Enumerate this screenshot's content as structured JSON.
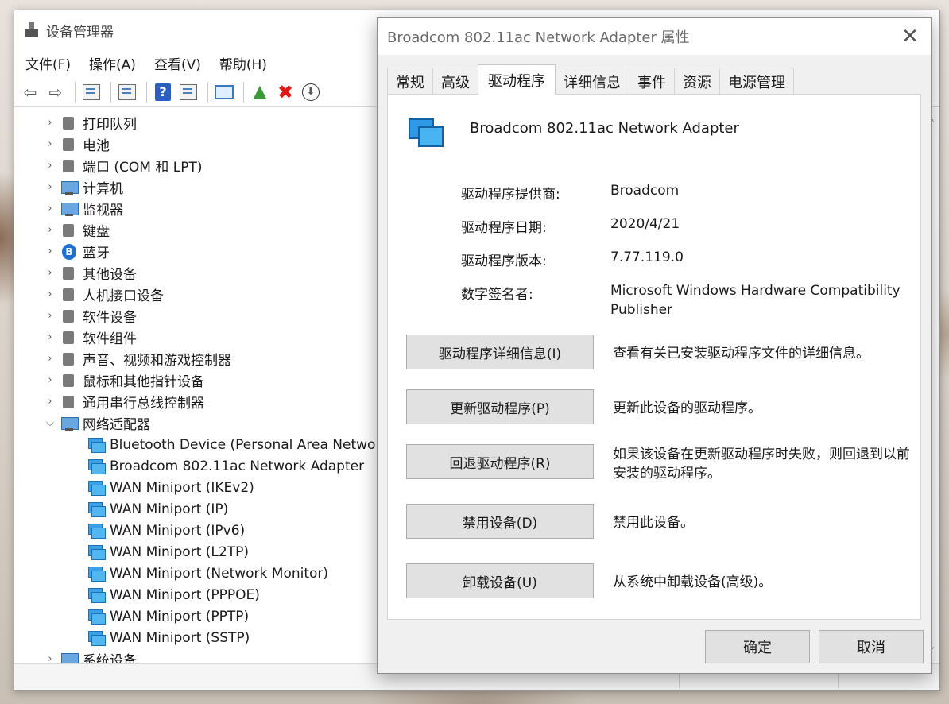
{
  "device_manager": {
    "title": "设备管理器",
    "menu": [
      "文件(F)",
      "操作(A)",
      "查看(V)",
      "帮助(H)"
    ],
    "tree": [
      {
        "label": "打印队列",
        "expanded": false,
        "icon": "printer-icon"
      },
      {
        "label": "电池",
        "expanded": false,
        "icon": "battery-icon"
      },
      {
        "label": "端口 (COM 和 LPT)",
        "expanded": false,
        "icon": "port-icon"
      },
      {
        "label": "计算机",
        "expanded": false,
        "icon": "computer-icon"
      },
      {
        "label": "监视器",
        "expanded": false,
        "icon": "monitor-icon"
      },
      {
        "label": "键盘",
        "expanded": false,
        "icon": "keyboard-icon"
      },
      {
        "label": "蓝牙",
        "expanded": false,
        "icon": "bluetooth-icon"
      },
      {
        "label": "其他设备",
        "expanded": false,
        "icon": "unknown-device-icon"
      },
      {
        "label": "人机接口设备",
        "expanded": false,
        "icon": "hid-icon"
      },
      {
        "label": "软件设备",
        "expanded": false,
        "icon": "software-device-icon"
      },
      {
        "label": "软件组件",
        "expanded": false,
        "icon": "software-component-icon"
      },
      {
        "label": "声音、视频和游戏控制器",
        "expanded": false,
        "icon": "speaker-icon"
      },
      {
        "label": "鼠标和其他指针设备",
        "expanded": false,
        "icon": "mouse-icon"
      },
      {
        "label": "通用串行总线控制器",
        "expanded": false,
        "icon": "usb-icon"
      },
      {
        "label": "网络适配器",
        "expanded": true,
        "icon": "network-adapter-icon"
      }
    ],
    "network_children": [
      "Bluetooth Device (Personal Area Network)",
      "Broadcom 802.11ac Network Adapter",
      "WAN Miniport (IKEv2)",
      "WAN Miniport (IP)",
      "WAN Miniport (IPv6)",
      "WAN Miniport (L2TP)",
      "WAN Miniport (Network Monitor)",
      "WAN Miniport (PPPOE)",
      "WAN Miniport (PPTP)",
      "WAN Miniport (SSTP)"
    ],
    "last_category": "系统设备"
  },
  "dialog": {
    "title": "Broadcom 802.11ac Network Adapter 属性",
    "tabs": [
      "常规",
      "高级",
      "驱动程序",
      "详细信息",
      "事件",
      "资源",
      "电源管理"
    ],
    "active_tab": "驱动程序",
    "adapter_name": "Broadcom 802.11ac Network Adapter",
    "properties": [
      {
        "label": "驱动程序提供商:",
        "value": "Broadcom"
      },
      {
        "label": "驱动程序日期:",
        "value": "2020/4/21"
      },
      {
        "label": "驱动程序版本:",
        "value": "7.77.119.0"
      },
      {
        "label": "数字签名者:",
        "value": "Microsoft Windows Hardware Compatibility Publisher"
      }
    ],
    "actions": [
      {
        "button": "驱动程序详细信息(I)",
        "desc": "查看有关已安装驱动程序文件的详细信息。"
      },
      {
        "button": "更新驱动程序(P)",
        "desc": "更新此设备的驱动程序。"
      },
      {
        "button": "回退驱动程序(R)",
        "desc": "如果该设备在更新驱动程序时失败，则回退到以前安装的驱动程序。"
      },
      {
        "button": "禁用设备(D)",
        "desc": "禁用此设备。"
      },
      {
        "button": "卸载设备(U)",
        "desc": "从系统中卸载设备(高级)。"
      }
    ],
    "ok": "确定",
    "cancel": "取消"
  },
  "colors": {
    "accent_blue": "#2e9ae6",
    "delete_red": "#e01818",
    "button_face": "#e1e1e1"
  }
}
